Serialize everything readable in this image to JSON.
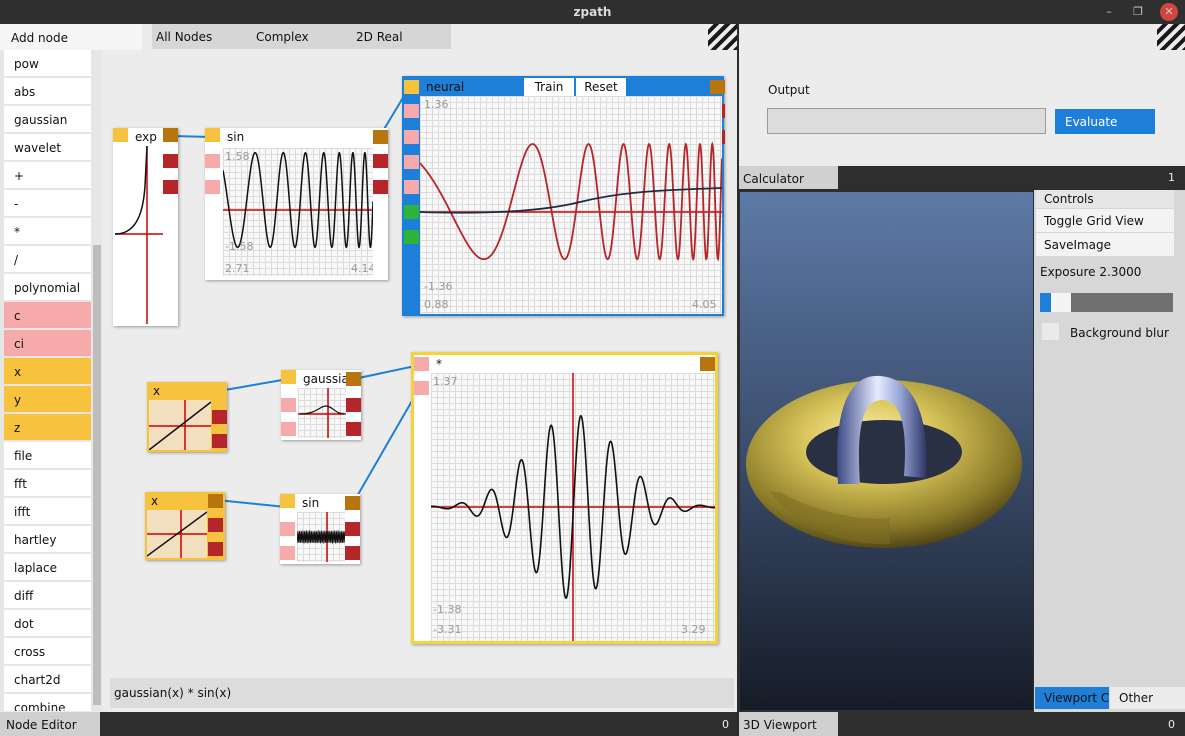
{
  "window": {
    "title": "zpath",
    "minimize": "–",
    "restore": "❐",
    "close": "✕"
  },
  "node_editor": {
    "add_node_tab": "Add node",
    "category_tabs": [
      "All Nodes",
      "Complex",
      "2D Real"
    ],
    "node_list": [
      {
        "label": "pow",
        "kind": "plain"
      },
      {
        "label": "abs",
        "kind": "plain"
      },
      {
        "label": "gaussian",
        "kind": "plain"
      },
      {
        "label": "wavelet",
        "kind": "plain"
      },
      {
        "label": "+",
        "kind": "plain"
      },
      {
        "label": "-",
        "kind": "plain"
      },
      {
        "label": "*",
        "kind": "plain"
      },
      {
        "label": "/",
        "kind": "plain"
      },
      {
        "label": "polynomial",
        "kind": "plain"
      },
      {
        "label": "c",
        "kind": "pink"
      },
      {
        "label": "ci",
        "kind": "pink"
      },
      {
        "label": "x",
        "kind": "yel"
      },
      {
        "label": "y",
        "kind": "yel"
      },
      {
        "label": "z",
        "kind": "yel"
      },
      {
        "label": "file",
        "kind": "plain"
      },
      {
        "label": "fft",
        "kind": "plain"
      },
      {
        "label": "ifft",
        "kind": "plain"
      },
      {
        "label": "hartley",
        "kind": "plain"
      },
      {
        "label": "laplace",
        "kind": "plain"
      },
      {
        "label": "diff",
        "kind": "plain"
      },
      {
        "label": "dot",
        "kind": "plain"
      },
      {
        "label": "cross",
        "kind": "plain"
      },
      {
        "label": "chart2d",
        "kind": "plain"
      },
      {
        "label": "combine",
        "kind": "plain"
      }
    ],
    "nodes": {
      "exp": {
        "title": "exp"
      },
      "sin1": {
        "title": "sin",
        "ymax": "1.58",
        "ymin": "-1.58",
        "xmin": "2.71",
        "xmax": "4.14"
      },
      "neural": {
        "title": "neural",
        "train": "Train",
        "reset": "Reset",
        "ymax": "1.36",
        "ymin": "-1.36",
        "xmin": "0.88",
        "xmax": "4.05"
      },
      "x1": {
        "title": "x"
      },
      "gaussian": {
        "title": "gaussian"
      },
      "x2": {
        "title": "x"
      },
      "sin2": {
        "title": "sin"
      },
      "mul": {
        "title": "*",
        "ymax": "1.37",
        "ymin": "-1.38",
        "xmin": "-3.31",
        "xmax": "3.29"
      }
    },
    "expression": "gaussian(x) * sin(x)",
    "footer_tab": "Node Editor",
    "footer_count": "0"
  },
  "calculator": {
    "output_label": "Output",
    "output_value": "",
    "evaluate_button": "Evaluate",
    "footer_tab": "Calculator",
    "footer_count": "1"
  },
  "viewport": {
    "controls_tab": "Controls",
    "toggle_grid": "Toggle Grid View",
    "save_image": "SaveImage",
    "exposure_label": "Exposure 2.3000",
    "exposure_value": 2.3,
    "exposure_slider_fraction": 0.23,
    "background_blur_label": "Background blur",
    "background_blur_checked": false,
    "bottom_tabs": [
      "Viewport Co",
      "Other"
    ],
    "footer_tab": "3D Viewport",
    "footer_count": "0"
  },
  "colors": {
    "accent": "#1e7fd8",
    "port_input": "#f7aaaa",
    "port_output": "#b5262a",
    "variable": "#f7c33e",
    "selected_border": "#f8d23a"
  }
}
